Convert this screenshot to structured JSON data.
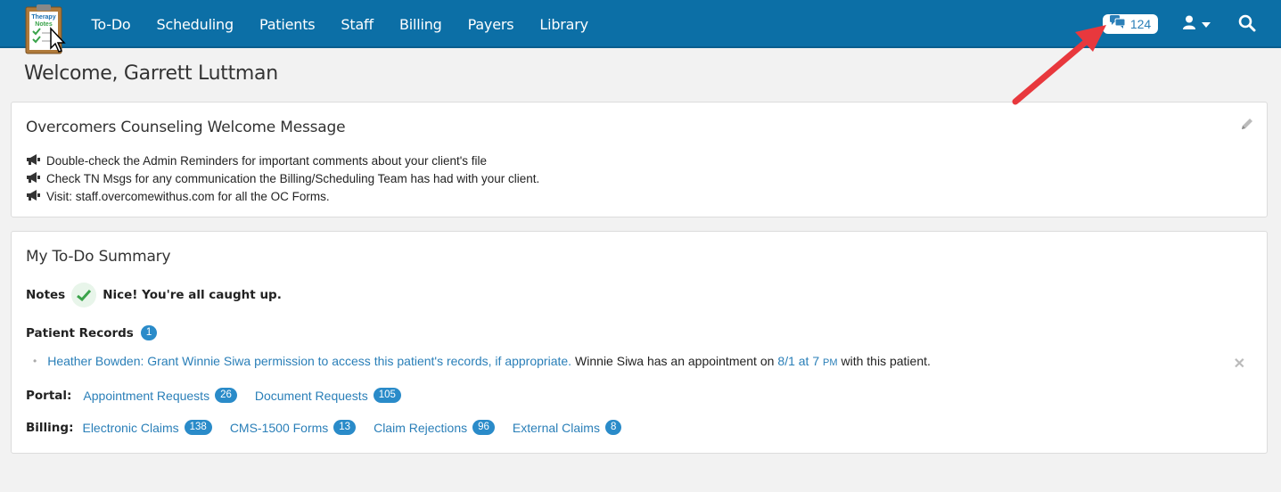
{
  "nav": {
    "logo_text_top": "Therapy",
    "logo_text_bottom": "Notes",
    "items": [
      "To-Do",
      "Scheduling",
      "Patients",
      "Staff",
      "Billing",
      "Payers",
      "Library"
    ],
    "messages_count": "124"
  },
  "welcome": "Welcome, Garrett Luttman",
  "welcome_card": {
    "title": "Overcomers Counseling Welcome Message",
    "lines": [
      "Double-check the Admin Reminders for important comments about your client's file",
      "Check TN Msgs for any communication the Billing/Scheduling Team has had with your client.",
      "Visit: staff.overcomewithus.com for all the OC Forms."
    ]
  },
  "todo": {
    "title": "My To-Do Summary",
    "notes_label": "Notes",
    "notes_status": "Nice! You're all caught up.",
    "records_label": "Patient Records",
    "records_count": "1",
    "record_link": "Heather Bowden: Grant Winnie Siwa permission to access this patient's records, if appropriate.",
    "record_text_1": "Winnie Siwa has an appointment on",
    "record_date": "8/1 at 7",
    "record_ampm": "PM",
    "record_text_2": "with this patient.",
    "portal_label": "Portal:",
    "portal_links": [
      {
        "label": "Appointment Requests",
        "count": "26"
      },
      {
        "label": "Document Requests",
        "count": "105"
      }
    ],
    "billing_label": "Billing:",
    "billing_links": [
      {
        "label": "Electronic Claims",
        "count": "138"
      },
      {
        "label": "CMS-1500 Forms",
        "count": "13"
      },
      {
        "label": "Claim Rejections",
        "count": "96"
      },
      {
        "label": "External Claims",
        "count": "8"
      }
    ]
  },
  "colors": {
    "navbar": "#0c6fa6",
    "link": "#2a7fb8",
    "badge": "#2a8bc9",
    "arrow": "#e8383d",
    "check": "#3aa34a"
  }
}
